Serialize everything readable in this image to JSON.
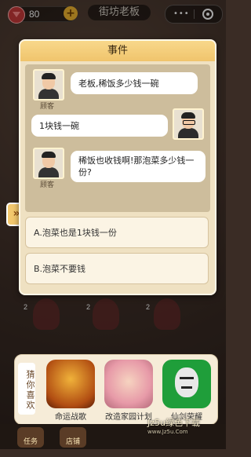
{
  "topbar": {
    "gem_count": "80",
    "store_title": "街坊老板"
  },
  "dialog": {
    "title": "事件",
    "messages": [
      {
        "side": "left",
        "text": "老板,稀饭多少钱一碗",
        "speaker": "顾客"
      },
      {
        "side": "right",
        "text": "1块钱一碗",
        "speaker": ""
      },
      {
        "side": "left",
        "text": "稀饭也收钱啊!那泡菜多少钱一份?",
        "speaker": "顾客"
      }
    ],
    "options": [
      "A.泡菜也是1块钱一份",
      "B.泡菜不要钱"
    ]
  },
  "scene": {
    "seat_numbers": [
      "2",
      "2",
      "2"
    ]
  },
  "guess": {
    "label": "猜你喜欢",
    "games": [
      {
        "name": "命运战歌",
        "color": "#c26b1e",
        "icon": "warrior-icon"
      },
      {
        "name": "改造家园计划",
        "color": "#e9a3b0",
        "icon": "girl-icon"
      },
      {
        "name": "仙剑荣耀",
        "color": "#1f9e3a",
        "icon": "meme-face-icon"
      }
    ]
  },
  "bottom_nav": {
    "items": [
      "任务",
      "店铺"
    ]
  },
  "watermark": {
    "text": "Jz5u绿色下载",
    "sub": "www.Jz5u.Com"
  }
}
